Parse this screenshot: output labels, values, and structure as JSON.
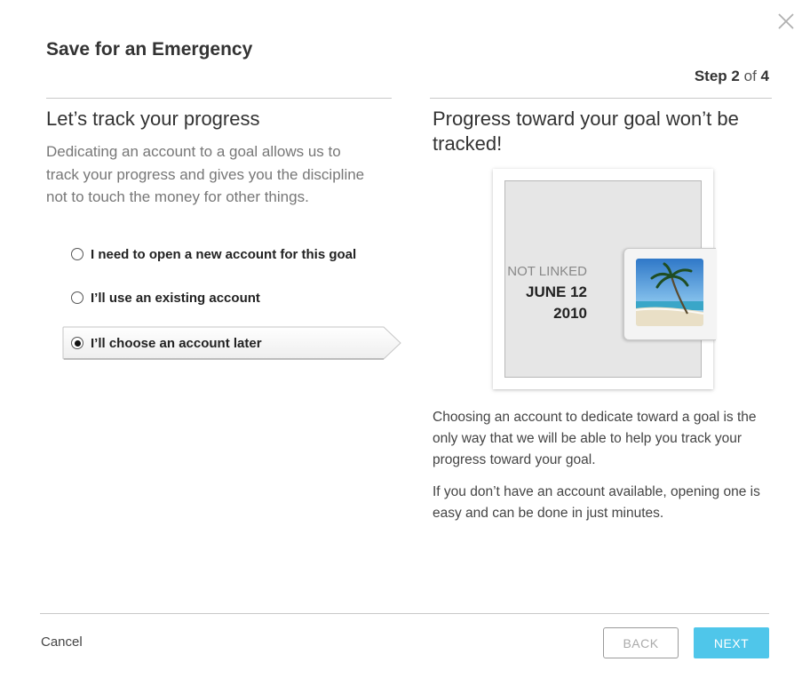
{
  "dialog": {
    "title": "Save for an Emergency",
    "step": {
      "label": "Step",
      "current": "2",
      "of": "of",
      "total": "4"
    }
  },
  "left": {
    "heading": "Let’s track your progress",
    "description": "Dedicating an account to a goal allows us to track your progress and gives you the discipline not to touch the money for other things.",
    "options": [
      {
        "label": "I need to open a new account for this goal",
        "selected": false
      },
      {
        "label": "I’ll use an existing account",
        "selected": false
      },
      {
        "label": "I’ll choose an account later",
        "selected": true
      }
    ]
  },
  "right": {
    "heading": "Progress toward your goal won’t be tracked!",
    "illustration": {
      "status": "NOT LINKED",
      "date_line1": "JUNE 12",
      "date_line2": "2010",
      "image_icon": "beach-palm-photo"
    },
    "paragraph1": "Choosing an account to dedicate toward a goal is the only way that we will be able to help you track your progress toward your goal.",
    "paragraph2": "If you don’t have an account available, opening one is easy and can be done in just minutes."
  },
  "footer": {
    "cancel_label": "Cancel",
    "back_label": "BACK",
    "next_label": "NEXT"
  },
  "colors": {
    "accent": "#4fc6ea",
    "divider": "#c8c8c8"
  }
}
